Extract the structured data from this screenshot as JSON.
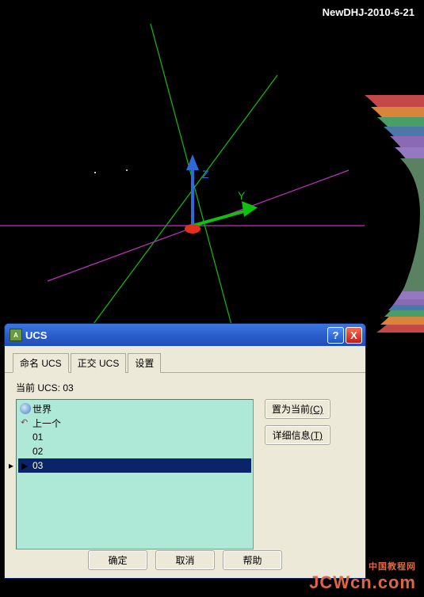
{
  "watermark_top": "NewDHJ-2010-6-21",
  "watermark_bottom_cn": "中国教程网",
  "watermark_bottom": "JCWcn.com",
  "axis": {
    "z": "Z",
    "y": "Y"
  },
  "dialog": {
    "title": "UCS",
    "help": "?",
    "close": "X",
    "tabs": {
      "named": "命名 UCS",
      "ortho": "正交 UCS",
      "settings": "设置"
    },
    "current_label": "当前 UCS:",
    "current_value": "03",
    "list": {
      "world": "世界",
      "prev": "上一个",
      "i1": "01",
      "i2": "02",
      "i3": "03"
    },
    "side": {
      "set_current": "置为当前",
      "set_current_key": "(C)",
      "details": "详细信息",
      "details_key": "(T)"
    },
    "buttons": {
      "ok": "确定",
      "cancel": "取消",
      "help": "帮助"
    }
  }
}
